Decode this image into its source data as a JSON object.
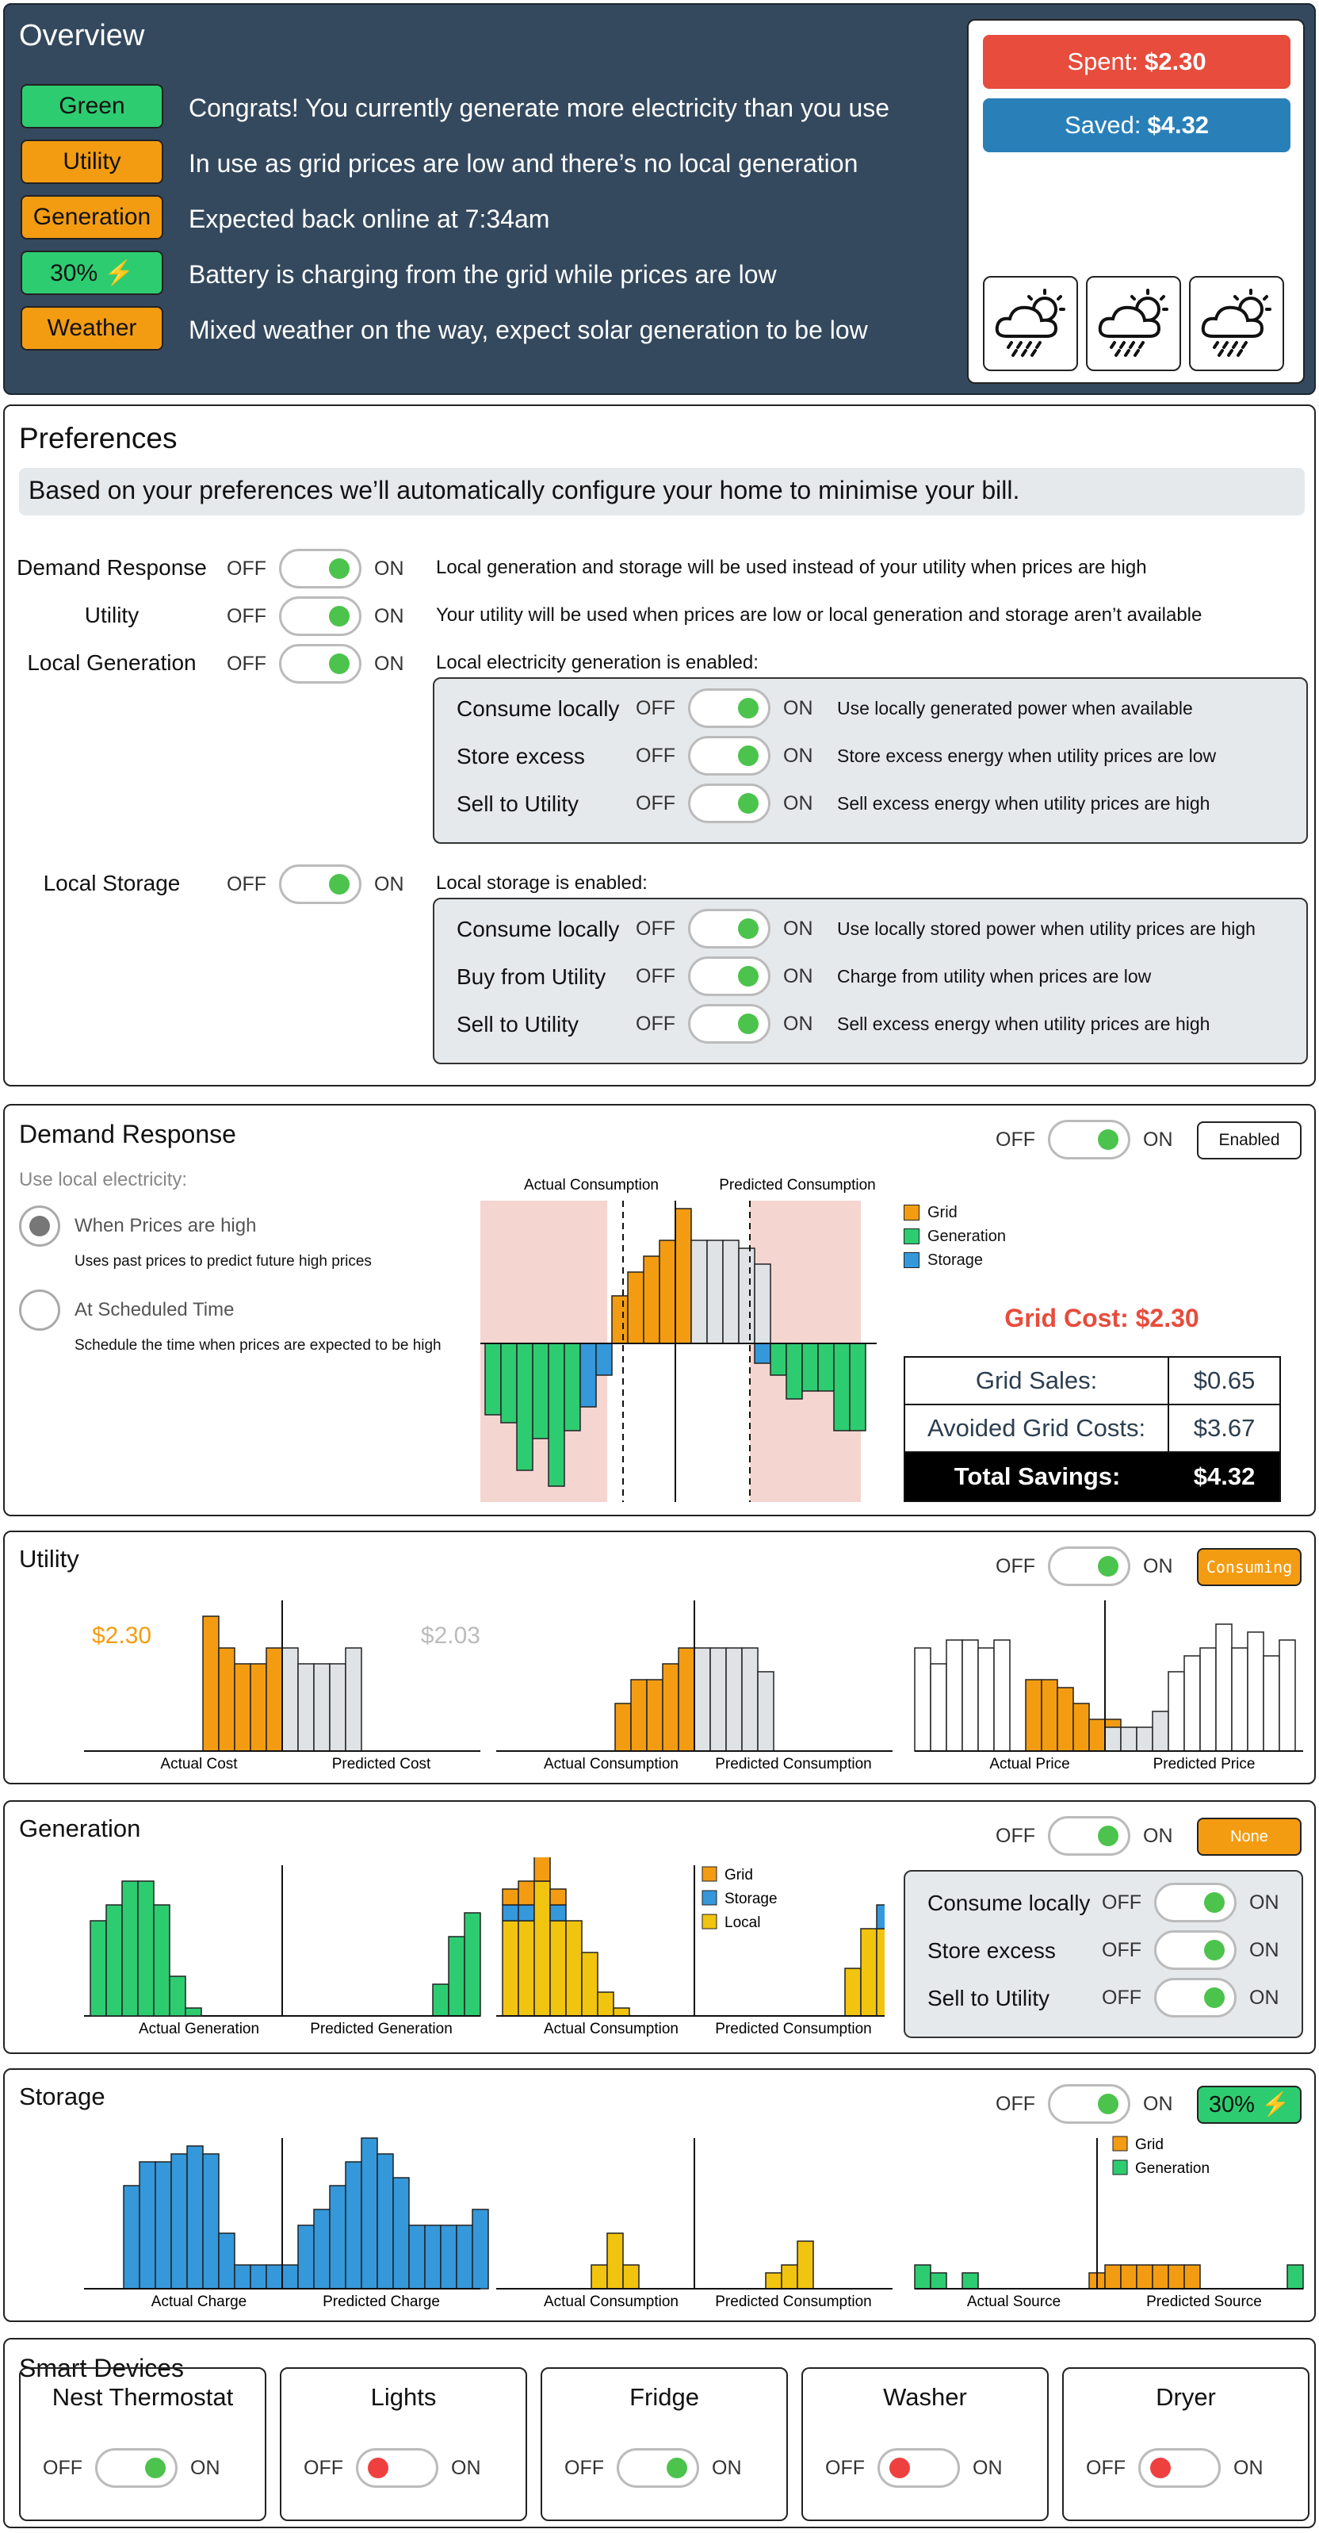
{
  "overview": {
    "title": "Overview",
    "colors": {
      "panel_bg": "#34495e",
      "green": "#2ecc71",
      "orange": "#f39c12",
      "red": "#e74c3c",
      "blue": "#2980b9"
    },
    "rows": [
      {
        "badge": "Green",
        "badge_color": "#2ecc71",
        "text": "Congrats! You currently generate more electricity than you use"
      },
      {
        "badge": "Utility",
        "badge_color": "#f39c12",
        "text": "In use as grid prices are low and there’s no local generation"
      },
      {
        "badge": "Generation",
        "badge_color": "#f39c12",
        "text": "Expected back online at 7:34am"
      },
      {
        "badge": "30% ⚡",
        "badge_color": "#2ecc71",
        "text": "Battery is charging from the grid while prices are low"
      },
      {
        "badge": "Weather",
        "badge_color": "#f39c12",
        "text": "Mixed weather on the way, expect solar generation to be low"
      }
    ],
    "spent_label": "Spent:",
    "spent_value": "$2.30",
    "saved_label": "Saved:",
    "saved_value": "$4.32",
    "weather_icons": [
      "cloud-rain-sun-icon",
      "cloud-rain-sun-icon",
      "cloud-rain-sun-icon"
    ]
  },
  "toggle": {
    "off": "OFF",
    "on": "ON"
  },
  "preferences": {
    "title": "Preferences",
    "banner": "Based on your preferences we’ll automatically configure your home to minimise your bill.",
    "rows": [
      {
        "label": "Demand Response",
        "state": "on",
        "desc": "Local generation and storage will be used instead of your utility when prices are high"
      },
      {
        "label": "Utility",
        "state": "on",
        "desc": "Your utility will be used when prices are low or local generation and storage aren’t available"
      },
      {
        "label": "Local Generation",
        "state": "on",
        "desc": "Local electricity generation is enabled:"
      },
      {
        "label": "Local Storage",
        "state": "on",
        "desc": "Local storage is enabled:"
      }
    ],
    "generation_sub": [
      {
        "label": "Consume locally",
        "state": "on",
        "desc": "Use locally generated power when available"
      },
      {
        "label": "Store excess",
        "state": "on",
        "desc": "Store excess energy when utility prices are low"
      },
      {
        "label": "Sell to Utility",
        "state": "on",
        "desc": "Sell excess energy when utility prices are high"
      }
    ],
    "storage_sub": [
      {
        "label": "Consume locally",
        "state": "on",
        "desc": "Use locally stored power when utility prices are high"
      },
      {
        "label": "Buy from Utility",
        "state": "on",
        "desc": "Charge from utility when prices are low"
      },
      {
        "label": "Sell to Utility",
        "state": "on",
        "desc": "Sell excess energy when utility prices are high"
      }
    ]
  },
  "demand": {
    "title": "Demand Response",
    "state": "on",
    "status": "Enabled",
    "use_label": "Use local electricity:",
    "options": [
      {
        "label": "When Prices are high",
        "desc": "Uses past prices to predict future high prices",
        "selected": true
      },
      {
        "label": "At Scheduled Time",
        "desc": "Schedule the time when prices are expected to be high",
        "selected": false
      }
    ],
    "legend": [
      {
        "name": "Grid",
        "color": "#f39c12"
      },
      {
        "name": "Generation",
        "color": "#2ecc71"
      },
      {
        "name": "Storage",
        "color": "#3498db"
      }
    ],
    "grid_cost": "Grid Cost: $2.30",
    "table": [
      {
        "label": "Grid Sales:",
        "value": "$0.65"
      },
      {
        "label": "Avoided Grid Costs:",
        "value": "$3.67"
      }
    ],
    "total_label": "Total Savings:",
    "total_value": "$4.32"
  },
  "utility": {
    "title": "Utility",
    "state": "on",
    "status": "Consuming"
  },
  "generation": {
    "title": "Generation",
    "state": "on",
    "status": "None",
    "legend": [
      {
        "name": "Grid",
        "color": "#f39c12"
      },
      {
        "name": "Storage",
        "color": "#3498db"
      },
      {
        "name": "Local",
        "color": "#f1c40f"
      }
    ],
    "sub": [
      {
        "label": "Consume locally",
        "state": "on"
      },
      {
        "label": "Store excess",
        "state": "on"
      },
      {
        "label": "Sell to Utility",
        "state": "on"
      }
    ]
  },
  "storage": {
    "title": "Storage",
    "state": "on",
    "status": "30% ⚡",
    "legend": [
      {
        "name": "Grid",
        "color": "#f39c12"
      },
      {
        "name": "Generation",
        "color": "#2ecc71"
      }
    ]
  },
  "devices": {
    "title": "Smart Devices",
    "items": [
      {
        "name": "Nest Thermostat",
        "state": "on"
      },
      {
        "name": "Lights",
        "state": "off"
      },
      {
        "name": "Fridge",
        "state": "on"
      },
      {
        "name": "Washer",
        "state": "off"
      },
      {
        "name": "Dryer",
        "state": "off"
      }
    ]
  },
  "chart_data": [
    {
      "id": "dr",
      "type": "bar",
      "title": "",
      "xlabel": "",
      "ylabel": "",
      "top_labels": [
        "Actual Consumption",
        "Predicted Consumption"
      ],
      "series": [
        {
          "name": "Grid",
          "color": "#f39c12",
          "x": [
            3,
            4,
            5,
            7,
            8,
            9,
            10,
            11,
            12
          ],
          "values": [
            -0.6,
            -0.8,
            -0.5,
            0,
            0.6,
            0.9,
            1.1,
            1.3,
            1.7
          ]
        },
        {
          "name": "Predicted",
          "color": "#e0e3e5",
          "x": [
            13,
            14,
            15,
            16,
            17
          ],
          "values": [
            1.3,
            1.3,
            1.3,
            1.2,
            1.0
          ]
        },
        {
          "name": "Generation",
          "color": "#2ecc71",
          "x": [
            0,
            1,
            2,
            3,
            4,
            5
          ],
          "values": [
            -0.9,
            -1.0,
            -1.6,
            -1.2,
            -1.8,
            -1.1
          ]
        },
        {
          "name": "Storage",
          "color": "#3498db",
          "x": [
            6,
            7
          ],
          "values": [
            -0.8,
            -0.4
          ]
        },
        {
          "name": "Predicted Storage",
          "color": "#3498db",
          "x": [
            17,
            18,
            19
          ],
          "values": [
            -0.25,
            -0.2,
            -0.4
          ]
        },
        {
          "name": "Predicted Generation",
          "color": "#2ecc71",
          "x": [
            18,
            19,
            20,
            21,
            22,
            23
          ],
          "values": [
            -0.4,
            -0.7,
            -0.6,
            -0.6,
            -1.1,
            -1.1
          ]
        }
      ]
    },
    {
      "id": "u1",
      "type": "bar",
      "amount_left": "$2.30",
      "amount_right": "$2.03",
      "bottom_labels": [
        "Actual Cost",
        "Predicted Cost"
      ],
      "actual": [
        1.7,
        1.3,
        1.1,
        1.1,
        1.3
      ],
      "predicted": [
        1.3,
        1.1,
        1.1,
        1.1,
        1.3
      ]
    },
    {
      "id": "u2",
      "type": "bar",
      "bottom_labels": [
        "Actual Consumption",
        "Predicted Consumption"
      ],
      "actual": [
        0.6,
        0.9,
        0.9,
        1.1,
        1.3
      ],
      "predicted": [
        1.3,
        1.3,
        1.3,
        1.3,
        1.0
      ]
    },
    {
      "id": "u3",
      "type": "bar",
      "bottom_labels": [
        "Actual Price",
        "Predicted Price"
      ],
      "past": [
        1.3,
        1.1,
        1.4,
        1.4,
        1.3,
        1.4
      ],
      "actual": [
        0.9,
        0.9,
        0.8,
        0.6,
        0.4,
        0.4
      ],
      "predicted": [
        0.3,
        0.3,
        0.3,
        0.5,
        1.0,
        1.2,
        1.3,
        1.6,
        1.3,
        1.5,
        1.2,
        1.4
      ]
    },
    {
      "id": "g1",
      "type": "bar",
      "bottom_labels": [
        "Actual Generation",
        "Predicted Generation"
      ],
      "actual": [
        1.2,
        1.4,
        1.7,
        1.7,
        1.4,
        0.5,
        0.1
      ],
      "predicted": [
        0.4,
        1.0,
        1.3
      ]
    },
    {
      "id": "g2",
      "type": "bar",
      "bottom_labels": [
        "Actual Consumption",
        "Predicted Consumption"
      ],
      "local": [
        1.2,
        1.2,
        1.7,
        1.2,
        1.2,
        0.8,
        0.3,
        0.1
      ],
      "storage": [
        0.2,
        0.2,
        0,
        0.2,
        0,
        0,
        0,
        0
      ],
      "grid": [
        0.2,
        0.3,
        0.5,
        0.2,
        0,
        0,
        0,
        0
      ],
      "predicted_local": [
        0.6,
        1.1,
        1.1
      ],
      "predicted_storage": [
        0,
        0,
        0.3
      ]
    },
    {
      "id": "s1",
      "type": "bar",
      "bottom_labels": [
        "Actual Charge",
        "Predicted Charge"
      ],
      "actual": [
        1.3,
        1.6,
        1.6,
        1.7,
        1.8,
        1.7,
        0.7,
        0.3,
        0.3,
        0.3
      ],
      "predicted": [
        0.3,
        0.8,
        1.0,
        1.3,
        1.6,
        1.9,
        1.7,
        1.4,
        0.8,
        0.8,
        0.8,
        0.8,
        1.0
      ]
    },
    {
      "id": "s2",
      "type": "bar",
      "bottom_labels": [
        "Actual Consumption",
        "Predicted Consumption"
      ],
      "actual": [
        0.3,
        0.7,
        0.3
      ],
      "predicted": [
        0.2,
        0.3,
        0.6
      ]
    },
    {
      "id": "s3",
      "type": "bar",
      "bottom_labels": [
        "Actual Source",
        "Predicted Source"
      ],
      "generation": [
        0.3,
        0.2,
        0,
        0.2
      ],
      "grid": [
        0.2,
        0.3,
        0.3,
        0.3,
        0.3,
        0.3,
        0.3
      ],
      "predicted_generation": [
        0.3
      ]
    }
  ]
}
